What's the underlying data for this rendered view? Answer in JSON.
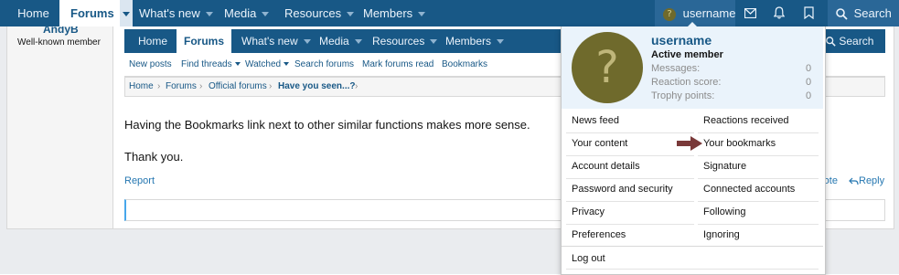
{
  "topnav": {
    "home": "Home",
    "forums": "Forums",
    "whats_new": "What's new",
    "media": "Media",
    "resources": "Resources",
    "members": "Members",
    "username": "username",
    "search": "Search"
  },
  "sidebar": {
    "username": "AndyB",
    "user_title": "Well-known member"
  },
  "inner": {
    "nav": {
      "home": "Home",
      "forums": "Forums",
      "whats_new": "What's new",
      "media": "Media",
      "resources": "Resources",
      "members": "Members",
      "search": "Search"
    },
    "subnav": [
      "New posts",
      "Find threads",
      "Watched",
      "Search forums",
      "Mark forums read",
      "Bookmarks"
    ],
    "breadcrumb": [
      "Home",
      "Forums",
      "Official forums",
      "Have you seen...?"
    ]
  },
  "post": {
    "line1": "Having the Bookmarks link next to other similar functions makes more sense.",
    "line2": "Thank you.",
    "report": "Report",
    "quote": "Quote",
    "reply": "Reply"
  },
  "menu": {
    "username": "username",
    "user_title": "Active member",
    "stats": [
      {
        "label": "Messages:",
        "value": "0"
      },
      {
        "label": "Reaction score:",
        "value": "0"
      },
      {
        "label": "Trophy points:",
        "value": "0"
      }
    ],
    "left": [
      "News feed",
      "Your content",
      "Account details",
      "Password and security",
      "Privacy",
      "Preferences"
    ],
    "right": [
      "Reactions received",
      "Your bookmarks",
      "Signature",
      "Connected accounts",
      "Following",
      "Ignoring"
    ],
    "logout": "Log out"
  },
  "icons": {
    "avatar_glyph": "?"
  },
  "colors": {
    "navbar": "#185886",
    "link": "#2577b1",
    "arrow": "#7a3a3a",
    "avatar": "#6f6a2c"
  }
}
